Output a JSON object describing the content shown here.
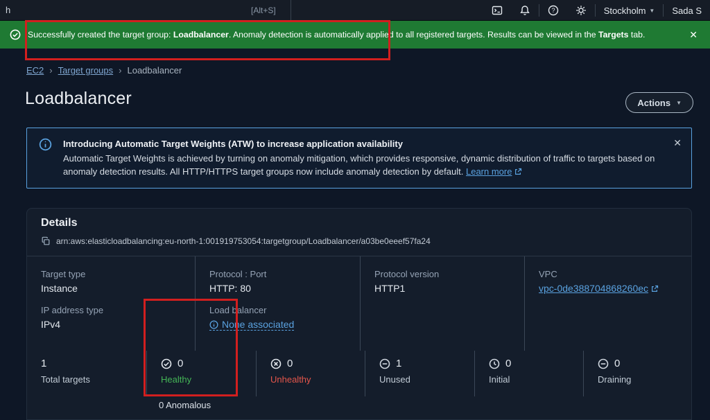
{
  "colors": {
    "success_green": "#1f7a33",
    "healthy_green": "#44b556",
    "unhealthy_red": "#e5564b",
    "link_blue": "#5aa2e0",
    "annotation_red": "#d21f1f"
  },
  "topbar": {
    "search_text": "h",
    "search_shortcut": "[Alt+S]",
    "region_label": "Stockholm",
    "account_label": "Sada S"
  },
  "flashbar": {
    "message_prefix": "Successfully created the target group: ",
    "target_group_name": "Loadbalancer",
    "message_middle": ". Anomaly detection is automatically applied to all registered targets. Results can be viewed in the ",
    "targets_tab_name": "Targets",
    "message_suffix": " tab."
  },
  "breadcrumb": {
    "items": [
      "EC2",
      "Target groups",
      "Loadbalancer"
    ]
  },
  "page": {
    "title": "Loadbalancer",
    "actions_label": "Actions"
  },
  "info_banner": {
    "title": "Introducing Automatic Target Weights (ATW) to increase application availability",
    "body": "Automatic Target Weights is achieved by turning on anomaly mitigation, which provides responsive, dynamic distribution of traffic to targets based on anomaly detection results. All HTTP/HTTPS target groups now include anomaly detection by default.",
    "learn_more_label": "Learn more"
  },
  "details": {
    "header": "Details",
    "arn": "arn:aws:elasticloadbalancing:eu-north-1:001919753054:targetgroup/Loadbalancer/a03be0eeef57fa24",
    "fields": [
      {
        "label": "Target type",
        "value": "Instance"
      },
      {
        "label": "Protocol : Port",
        "value": "HTTP: 80"
      },
      {
        "label": "Protocol version",
        "value": "HTTP1"
      },
      {
        "label": "VPC",
        "value": "vpc-0de388704868260ec"
      },
      {
        "label": "IP address type",
        "value": "IPv4"
      },
      {
        "label": "Load balancer",
        "value": "None associated"
      }
    ],
    "stats": [
      {
        "value": "1",
        "label": "Total targets",
        "icon": "none"
      },
      {
        "value": "0",
        "label": "Healthy",
        "icon": "check-circle"
      },
      {
        "value": "0",
        "label": "Unhealthy",
        "icon": "x-circle"
      },
      {
        "value": "1",
        "label": "Unused",
        "icon": "minus-circle"
      },
      {
        "value": "0",
        "label": "Initial",
        "icon": "clock"
      },
      {
        "value": "0",
        "label": "Draining",
        "icon": "minus-circle"
      }
    ],
    "anomalous_label": "0 Anomalous"
  }
}
